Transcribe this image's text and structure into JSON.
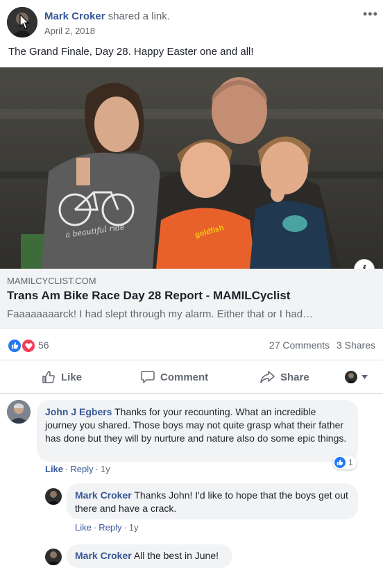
{
  "post": {
    "author": "Mark Croker",
    "verb": "shared a link.",
    "date": "April 2, 2018",
    "text": "The Grand Finale, Day 28. Happy Easter one and all!",
    "more_icon": "•••"
  },
  "photo": {
    "shirt_text": "a beautiful ride",
    "info_icon": "i"
  },
  "link": {
    "domain": "MAMILCYCLIST.COM",
    "title": "Trans Am Bike Race Day 28 Report - MAMILCyclist",
    "description": "Faaaaaaaarck! I had slept through my alarm. Either that or I had…"
  },
  "stats": {
    "reaction_count": "56",
    "comments": "27 Comments",
    "shares": "3 Shares",
    "reaction_icons": [
      "like-icon",
      "love-icon"
    ],
    "colors": {
      "like": "#2078f4",
      "love": "#f33e58"
    }
  },
  "actions": {
    "like": "Like",
    "comment": "Comment",
    "share": "Share"
  },
  "comments": [
    {
      "author": "John J Egbers",
      "text": "Thanks for your recounting. What an incredible journey you shared. Those boys may not quite grasp what their father has done but they will by nurture and nature also do some epic things.",
      "like_label": "Like",
      "reply_label": "Reply",
      "time": "1y",
      "reaction_count": "1"
    },
    {
      "author": "Mark Croker",
      "text": "Thanks John! I'd like to hope that the boys get out there and have a crack.",
      "like_label": "Like",
      "reply_label": "Reply",
      "time": "1y"
    },
    {
      "author": "Mark Croker",
      "text": "All the best in June!"
    }
  ]
}
